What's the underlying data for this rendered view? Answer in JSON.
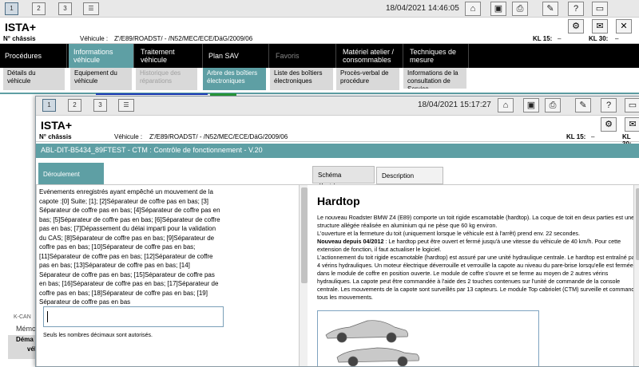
{
  "back": {
    "session_tabs": [
      "1",
      "2",
      "3"
    ],
    "timestamp": "18/04/2021 14:46:05",
    "app_title": "ISTA+",
    "vehicle": {
      "chassis_label": "N° châssis",
      "vehicle_label": "Véhicule :",
      "vehicle_value": "Z'/E89/ROADST/ - /N52/MEC/ECE/DäG/2009/06",
      "kl15_label": "KL 15:",
      "kl15_value": "–",
      "kl30_label": "KL 30:",
      "kl30_value": "–"
    },
    "nav": [
      "Procédures",
      "Informations véhicule",
      "Traitement véhicule",
      "Plan SAV",
      "Favoris",
      "Matériel atelier / consommables",
      "Techniques de mesure"
    ],
    "subnav": [
      "Détails du véhicule",
      "Equipement du véhicule",
      "Historique des réparations",
      "Arbre des boîtiers électroniques",
      "Liste des boîtiers électroniques",
      "Procès-verbal de procédure",
      "Informations de la consultation de Service"
    ],
    "side_labels": [
      "K-CAN",
      "Mémo",
      "Déma",
      "véhi"
    ]
  },
  "front": {
    "session_tabs": [
      "1",
      "2",
      "3"
    ],
    "timestamp": "18/04/2021 15:17:27",
    "app_title": "ISTA+",
    "vehicle": {
      "chassis_label": "N° châssis",
      "vehicle_label": "Véhicule :",
      "vehicle_value": "Z'/E89/ROADST/ - /N52/MEC/ECE/DäG/2009/06",
      "kl15_label": "KL 15:",
      "kl15_value": "–",
      "kl30_label": "KL 30:"
    },
    "abl_title": "ABL-DIT-B5434_89FTEST - CTM : Contrôle de fonctionnement - V.20",
    "tabs": {
      "deroulement": "Déroulement",
      "schema": "Schéma électrique",
      "description": "Description fonction"
    },
    "message": "Evénements enregistrés ayant empêché un mouvement de la capote :[0] Suite; [1]; [2]Séparateur de coffre pas en bas; [3] Séparateur de coffre pas en bas; [4]Séparateur de coffre pas en bas; [5]Séparateur de coffre pas en bas; [6]Séparateur de coffre pas en bas; [7]Dépassement du délai imparti pour la validation du CAS; [8]Séparateur de coffre pas en bas; [9]Séparateur de coffre pas en bas; [10]Séparateur de coffre pas en bas; [11]Séparateur de coffre pas en bas; [12]Séparateur de coffre pas en bas; [13]Séparateur de coffre pas en bas; [14] Séparateur de coffre pas en bas; [15]Séparateur de coffre pas en bas; [16]Séparateur de coffre pas en bas; [17]Séparateur de coffre pas en bas; [18]Séparateur de coffre pas en bas; [19] Séparateur de coffre pas en bas",
    "input_value": "",
    "hint": "Seuls les nombres décimaux sont autorisés.",
    "hardtop": {
      "heading": "Hardtop",
      "p1": "Le nouveau Roadster BMW Z4 (E89) comporte un toit rigide escamotable (hardtop). La coque de toit en deux parties est une structure allégée réalisée en aluminium qui ne pèse que 60 kg environ.",
      "p2": "L'ouverture et la fermeture du toit (uniquement lorsque le véhicule est à l'arrêt) prend env. 22 secondes.",
      "p3_bold": "Nouveau depuis 04/2012",
      "p3": " : Le hardtop peut être ouvert et fermé jusqu'à une vitesse du véhicule de 40 km/h. Pour cette extension de fonction, il faut actualiser le logiciel.",
      "p4": "L'actionnement du toit rigide escamotable (hardtop) est assuré par une unité hydraulique centrale. Le hardtop est entraîné par 4 vérins hydrauliques. Un moteur électrique déverrouille et verrouille la capote au niveau du pare-brise lorsqu'elle est fermée et dans le module de coffre en position ouverte. Le module de coffre s'ouvre et se ferme au moyen de 2 autres vérins hydrauliques. La capote peut être commandée à l'aide des 2 touches contenues sur l'unité de commande de la console centrale. Les mouvements de la capote sont surveillés par 13 capteurs. Le module Top cabriolet (CTM) surveille et commande tous les mouvements."
    }
  },
  "colors": {
    "accent": "#5e9fa4",
    "nav_bg": "#000000",
    "tab_grey": "#e4e4e4"
  }
}
